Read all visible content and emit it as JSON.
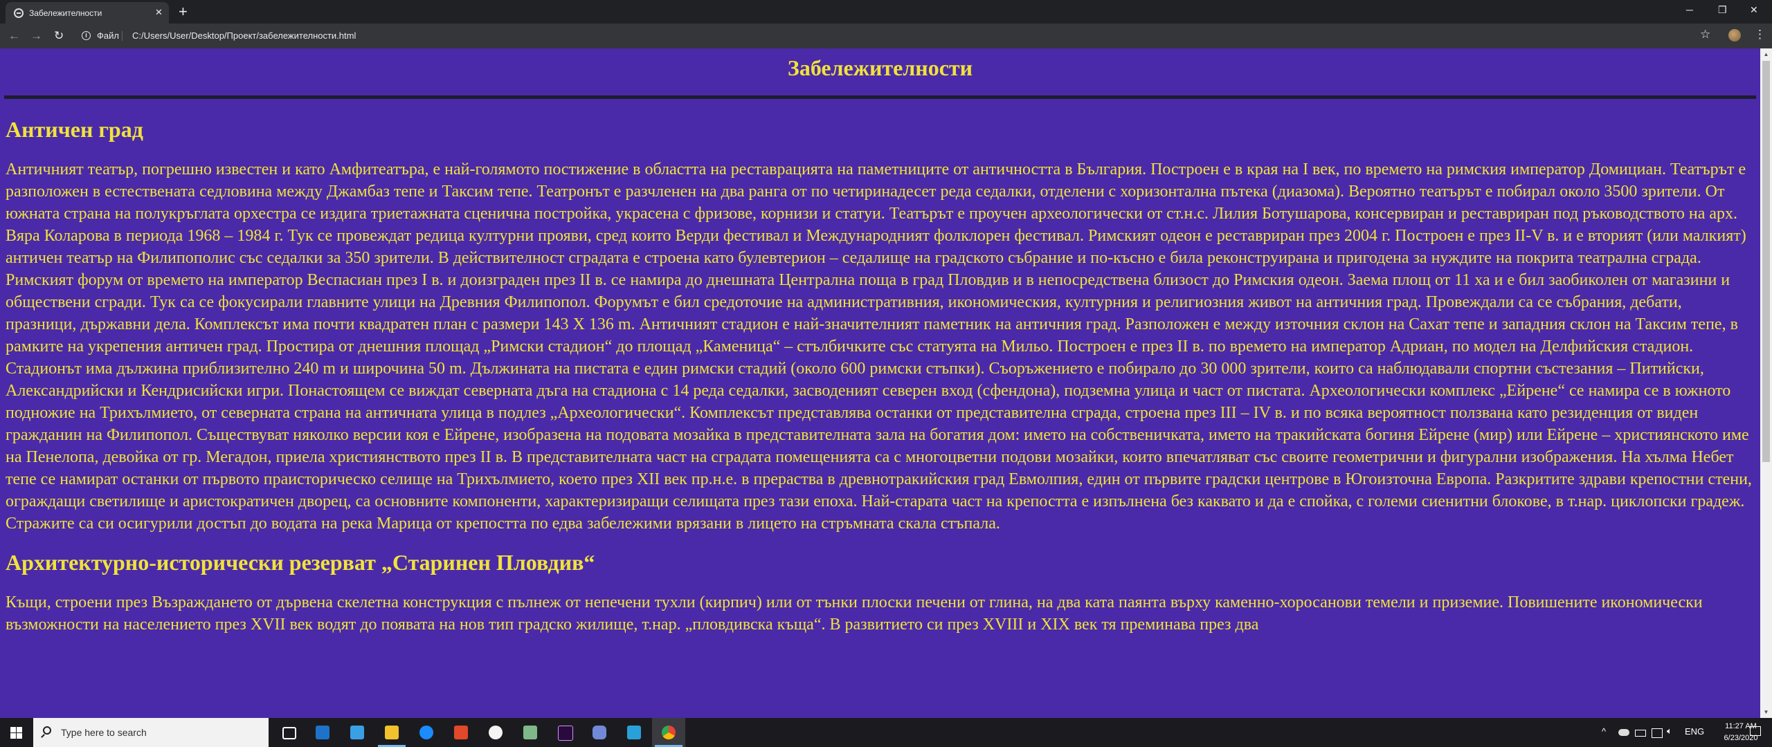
{
  "browser": {
    "tab_title": "Забележителности",
    "tab_close": "✕",
    "new_tab": "+",
    "window_minimize": "─",
    "window_maximize": "❐",
    "window_close": "✕",
    "nav_back": "←",
    "nav_forward": "→",
    "nav_reload": "↻",
    "info_glyph": "i",
    "scheme_label": "Файл",
    "url": "C:/Users/User/Desktop/Проект/забележителности.html",
    "star_glyph": "☆",
    "menu_glyph": "⋮"
  },
  "page": {
    "title": "Забележителности",
    "sections": [
      {
        "heading": "Античен град",
        "text": "Античният театър, погрешно известен и като Амфитеатъра, е най-голямото постижение в областта на реставрацията на паметниците от античността в България. Построен е в края на I век, по времето на римския император Домициан. Театърът е разположен в естествената седловина между Джамбаз тепе и Таксим тепе. Театронът е разчленен на два ранга от по четиринадесет реда седалки, отделени с хоризонтална пътека (диазома). Вероятно театърът е побирал около 3500 зрители. От южната страна на полукръглата орхестра се издига триетажната сценична постройка, украсена с фризове, корнизи и статуи. Театърът е проучен археологически от ст.н.с. Лилия Ботушарова, консервиран и реставриран под ръководството на арх. Вяра Коларова в периода 1968 – 1984 г. Тук се провеждат редица културни прояви, сред които Верди фестивал и Международният фолклорен фестивал. Римският одеон е реставриран през 2004 г. Построен е през II-V в. и е вторият (или малкият) античен театър на Филипополис със седалки за 350 зрители. В действителност сградата е строена като булевтерион – седалище на градското събрание и по-късно е била реконструирана и пригодена за нуждите на покрита театрална сграда. Римският форум от времето на император Веспасиан през I в. и доизграден през II в. се намира до днешната Централна поща в град Пловдив и в непосредствена близост до Римския одеон. Заема площ от 11 ха и е бил заобиколен от магазини и обществени сгради. Тук са се фокусирали главните улици на Древния Филипопол. Форумът е бил средоточие на административния, икономическия, културния и религиозния живот на античния град. Провеждали са се събрания, дебати, празници, държавни дела. Комплексът има почти квадратен план с размери 143 Х 136 m. Античният стадион е най-значителният паметник на античния град. Разположен е между източния склон на Сахат тепе и западния склон на Таксим тепе, в рамките на укрепения античен град. Простира от днешния площад „Римски стадион“ до площад „Каменица“ – стълбичките със статуята на Мильо. Построен е през II в. по времето на император Адриан, по модел на Делфийския стадион. Стадионът има дължина приблизително 240 m и широчина 50 m. Дължината на пистата е един римски стадий (около 600 римски стъпки). Съоръжението е побирало до 30 000 зрители, които са наблюдавали спортни състезания – Питийски, Александрийски и Кендрисийски игри. Понастоящем се виждат северната дъга на стадиона с 14 реда седалки, засводеният северен вход (сфендона), подземна улица и част от пистата. Археологически комплекс „Ейрене“ се намира се в южното подножие на Трихълмието, от северната страна на античната улица в подлез „Археологически“. Комплексът представлява останки от представителна сграда, строена през III – IV в. и по всяка вероятност ползвана като резиденция от виден гражданин на Филипопол. Съществуват няколко версии коя е Ейрене, изобразена на подовата мозайка в представителната зала на богатия дом: името на собственичката, името на тракийската богиня Ейрене (мир) или Ейрене – християнското име на Пенелопа, девойка от гр. Мегадон, приела християнството през II в. В представителната част на сградата помещенията са с многоцветни подови мозайки, които впечатляват със своите геометрични и фигурални изображения. На хълма Небет тепе се намират останки от първото праисторическо селище на Трихълмието, което през XII век пр.н.е. в прераства в древнотракийския град Евмолпия, един от първите градски центрове в Югоизточна Европа. Разкритите здрави крепостни стени, ограждащи светилище и аристократичен дворец, са основните компоненти, характеризиращи селищата през тази епоха. Най-старата част на крепостта е изпълнена без каквато и да е спойка, с големи сиенитни блокове, в т.нар. циклопски градеж. Стражите са си осигурили достъп до водата на река Марица от крепостта по едва забележими врязани в лицето на стръмната скала стъпала."
      },
      {
        "heading": "Архитектурно-исторически резерват „Старинен Пловдив“",
        "text": "Къщи, строени през Възраждането от дървена скелетна конструкция с пълнеж от непечени тухли (кирпич) или от тънки плоски печени от глина, на два ката паянта върху каменно-хоросанови темели и приземие. Повишените икономически възможности на населението през XVII век водят до появата на нов тип градско жилище, т.нар. „пловдивска къща“. В развитието си през XVIII и XIX век тя преминава през два"
      }
    ]
  },
  "taskbar": {
    "search_placeholder": "Type here to search",
    "apps": [
      "task-view-icon",
      "mail-icon",
      "store-icon",
      "file-explorer-icon",
      "messenger-icon",
      "office-icon",
      "itunes-icon",
      "notes-icon",
      "premiere-icon",
      "discord-icon",
      "app-icon",
      "chrome-icon"
    ],
    "tray_chevron": "^",
    "language": "ENG",
    "time": "11:27 AM",
    "date": "6/23/2020"
  },
  "colors": {
    "page_background": "#4a2aa8",
    "page_text": "#f0e33a",
    "browser_frame": "#202124",
    "browser_toolbar": "#35363a",
    "taskbar": "#1b1b1f"
  }
}
